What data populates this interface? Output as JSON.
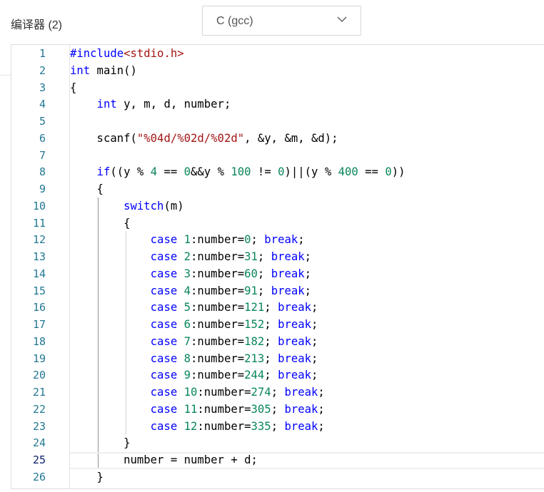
{
  "header": {
    "compiler_label": "编译器 (2)",
    "compiler_select": "C (gcc)"
  },
  "editor": {
    "current_line": 25,
    "lines": [
      [
        [
          "#include",
          "kw"
        ],
        [
          "<stdio.h>",
          "str"
        ]
      ],
      [
        [
          "int",
          "kw"
        ],
        [
          " main()",
          ""
        ]
      ],
      [
        [
          "{",
          ""
        ]
      ],
      [
        [
          "    ",
          ""
        ],
        [
          "int",
          "kw"
        ],
        [
          " y, m, d, number;",
          ""
        ]
      ],
      [],
      [
        [
          "    scanf(",
          ""
        ],
        [
          "\"%04d/%02d/%02d\"",
          "str"
        ],
        [
          ", &y, &m, &d);",
          ""
        ]
      ],
      [],
      [
        [
          "    ",
          ""
        ],
        [
          "if",
          "kw"
        ],
        [
          "((y % ",
          ""
        ],
        [
          "4",
          "num"
        ],
        [
          " == ",
          ""
        ],
        [
          "0",
          "num"
        ],
        [
          "&&y % ",
          ""
        ],
        [
          "100",
          "num"
        ],
        [
          " != ",
          ""
        ],
        [
          "0",
          "num"
        ],
        [
          ")||(y % ",
          ""
        ],
        [
          "400",
          "num"
        ],
        [
          " == ",
          ""
        ],
        [
          "0",
          "num"
        ],
        [
          "))",
          ""
        ]
      ],
      [
        [
          "    {",
          ""
        ]
      ],
      [
        [
          "        ",
          ""
        ],
        [
          "switch",
          "kw"
        ],
        [
          "(m)",
          ""
        ]
      ],
      [
        [
          "        {",
          ""
        ]
      ],
      [
        [
          "            ",
          ""
        ],
        [
          "case",
          "kw"
        ],
        [
          " ",
          ""
        ],
        [
          "1",
          "num"
        ],
        [
          ":number=",
          ""
        ],
        [
          "0",
          "num"
        ],
        [
          "; ",
          ""
        ],
        [
          "break",
          "kw"
        ],
        [
          ";",
          ""
        ]
      ],
      [
        [
          "            ",
          ""
        ],
        [
          "case",
          "kw"
        ],
        [
          " ",
          ""
        ],
        [
          "2",
          "num"
        ],
        [
          ":number=",
          ""
        ],
        [
          "31",
          "num"
        ],
        [
          "; ",
          ""
        ],
        [
          "break",
          "kw"
        ],
        [
          ";",
          ""
        ]
      ],
      [
        [
          "            ",
          ""
        ],
        [
          "case",
          "kw"
        ],
        [
          " ",
          ""
        ],
        [
          "3",
          "num"
        ],
        [
          ":number=",
          ""
        ],
        [
          "60",
          "num"
        ],
        [
          "; ",
          ""
        ],
        [
          "break",
          "kw"
        ],
        [
          ";",
          ""
        ]
      ],
      [
        [
          "            ",
          ""
        ],
        [
          "case",
          "kw"
        ],
        [
          " ",
          ""
        ],
        [
          "4",
          "num"
        ],
        [
          ":number=",
          ""
        ],
        [
          "91",
          "num"
        ],
        [
          "; ",
          ""
        ],
        [
          "break",
          "kw"
        ],
        [
          ";",
          ""
        ]
      ],
      [
        [
          "            ",
          ""
        ],
        [
          "case",
          "kw"
        ],
        [
          " ",
          ""
        ],
        [
          "5",
          "num"
        ],
        [
          ":number=",
          ""
        ],
        [
          "121",
          "num"
        ],
        [
          "; ",
          ""
        ],
        [
          "break",
          "kw"
        ],
        [
          ";",
          ""
        ]
      ],
      [
        [
          "            ",
          ""
        ],
        [
          "case",
          "kw"
        ],
        [
          " ",
          ""
        ],
        [
          "6",
          "num"
        ],
        [
          ":number=",
          ""
        ],
        [
          "152",
          "num"
        ],
        [
          "; ",
          ""
        ],
        [
          "break",
          "kw"
        ],
        [
          ";",
          ""
        ]
      ],
      [
        [
          "            ",
          ""
        ],
        [
          "case",
          "kw"
        ],
        [
          " ",
          ""
        ],
        [
          "7",
          "num"
        ],
        [
          ":number=",
          ""
        ],
        [
          "182",
          "num"
        ],
        [
          "; ",
          ""
        ],
        [
          "break",
          "kw"
        ],
        [
          ";",
          ""
        ]
      ],
      [
        [
          "            ",
          ""
        ],
        [
          "case",
          "kw"
        ],
        [
          " ",
          ""
        ],
        [
          "8",
          "num"
        ],
        [
          ":number=",
          ""
        ],
        [
          "213",
          "num"
        ],
        [
          "; ",
          ""
        ],
        [
          "break",
          "kw"
        ],
        [
          ";",
          ""
        ]
      ],
      [
        [
          "            ",
          ""
        ],
        [
          "case",
          "kw"
        ],
        [
          " ",
          ""
        ],
        [
          "9",
          "num"
        ],
        [
          ":number=",
          ""
        ],
        [
          "244",
          "num"
        ],
        [
          "; ",
          ""
        ],
        [
          "break",
          "kw"
        ],
        [
          ";",
          ""
        ]
      ],
      [
        [
          "            ",
          ""
        ],
        [
          "case",
          "kw"
        ],
        [
          " ",
          ""
        ],
        [
          "10",
          "num"
        ],
        [
          ":number=",
          ""
        ],
        [
          "274",
          "num"
        ],
        [
          "; ",
          ""
        ],
        [
          "break",
          "kw"
        ],
        [
          ";",
          ""
        ]
      ],
      [
        [
          "            ",
          ""
        ],
        [
          "case",
          "kw"
        ],
        [
          " ",
          ""
        ],
        [
          "11",
          "num"
        ],
        [
          ":number=",
          ""
        ],
        [
          "305",
          "num"
        ],
        [
          "; ",
          ""
        ],
        [
          "break",
          "kw"
        ],
        [
          ";",
          ""
        ]
      ],
      [
        [
          "            ",
          ""
        ],
        [
          "case",
          "kw"
        ],
        [
          " ",
          ""
        ],
        [
          "12",
          "num"
        ],
        [
          ":number=",
          ""
        ],
        [
          "335",
          "num"
        ],
        [
          "; ",
          ""
        ],
        [
          "break",
          "kw"
        ],
        [
          ";",
          ""
        ]
      ],
      [
        [
          "        }",
          ""
        ]
      ],
      [
        [
          "        number = number + d;",
          ""
        ]
      ],
      [
        [
          "    }",
          ""
        ]
      ]
    ]
  }
}
